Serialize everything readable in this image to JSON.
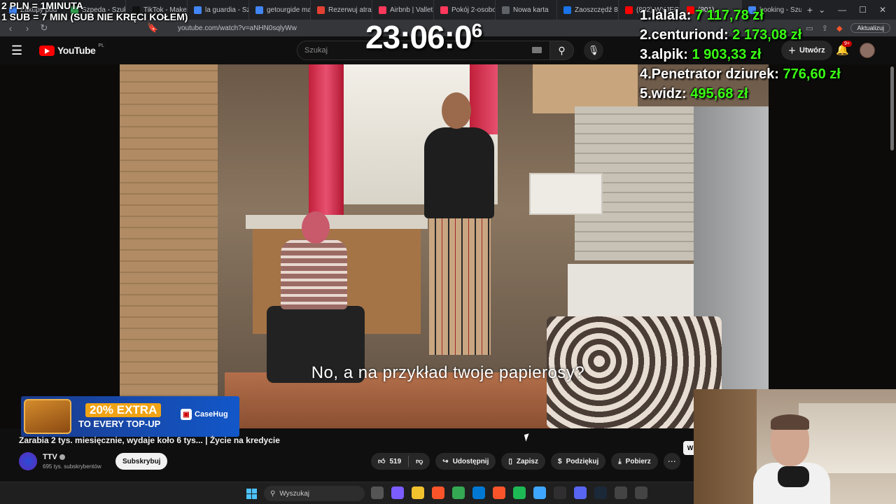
{
  "browser": {
    "tabs": [
      {
        "label": "Zakupy pod",
        "color": "#4285f4"
      },
      {
        "label": "Szpeda - Szuk",
        "color": "#34a853"
      },
      {
        "label": "TikTok - Make",
        "color": "#111111"
      },
      {
        "label": "la guardia - Szu",
        "color": "#4285f4"
      },
      {
        "label": "getourgide ma",
        "color": "#4285f4"
      },
      {
        "label": "Rezerwuj atrak",
        "color": "#e34133"
      },
      {
        "label": "Airbnb | Valleti",
        "color": "#ff385c"
      },
      {
        "label": "Pokój 2-osobo",
        "color": "#ff385c"
      },
      {
        "label": "Nowa karta",
        "color": "#5f6368"
      },
      {
        "label": "Zaoszczędź 85",
        "color": "#1a73e8"
      },
      {
        "label": "(802) WYJECH",
        "color": "#ff0000"
      },
      {
        "label": "(801)",
        "color": "#ff0000",
        "active": true
      },
      {
        "label": "booking - Szuk",
        "color": "#4285f4"
      }
    ],
    "new_tab": "+",
    "url": "youtube.com/watch?v=aNHN0sqlyWw",
    "update_label": "Aktualizuj"
  },
  "youtube": {
    "logo_text": "YouTube",
    "region": "PL",
    "search_placeholder": "Szukaj",
    "create_label": "Utwórz",
    "notif_count": "9+"
  },
  "video": {
    "subtitle": "No, a na przykład twoje papierosy?",
    "title": "Zarabia 2 tys. miesięcznie, wydaje koło 6 tys... | Życie na kredycie",
    "channel": "TTV",
    "subscribers": "695 tys. subskrybentów",
    "subscribe_label": "Subskrybuj",
    "likes": "519",
    "share_label": "Udostępnij",
    "save_label": "Zapisz",
    "thanks_label": "Podziękuj",
    "download_label": "Pobierz",
    "side_peek": "W"
  },
  "overlays": {
    "donation_rate_line1": "2 PLN =  1MINUTA",
    "donation_rate_line2": "1 SUB = 7 MIN (SUB NIE KRĘCI KOŁEM)",
    "timer": "23:06:0",
    "timer_sup": "6",
    "leaderboard": [
      {
        "rank": "1.",
        "name": "lalala:",
        "amount": "7 117,78 zł"
      },
      {
        "rank": "2.",
        "name": "centuriond:",
        "amount": "2 173,08 zł"
      },
      {
        "rank": "3.",
        "name": "alpik:",
        "amount": "1 903,33 zł"
      },
      {
        "rank": "4.",
        "name": "Penetrator dziurek:",
        "amount": "776,60 zł"
      },
      {
        "rank": "5.",
        "name": "widz:",
        "amount": "495,68 zł"
      }
    ],
    "ad": {
      "headline": "20% EXTRA",
      "subline": "TO EVERY TOP-UP",
      "brand": "CaseHug"
    }
  },
  "taskbar": {
    "search_placeholder": "Wyszukaj",
    "apps": [
      "file-icon",
      "copilot-icon",
      "folder-icon",
      "brave-icon",
      "chrome-icon",
      "store-icon",
      "brave-icon",
      "spotify-icon",
      "notes-icon",
      "obs-icon",
      "discord-icon",
      "steam-icon",
      "app-icon",
      "app-icon"
    ]
  },
  "colors": {
    "leader_amount": "#39ff14",
    "yt_red": "#ff0000",
    "bg": "#0f0f0f"
  }
}
